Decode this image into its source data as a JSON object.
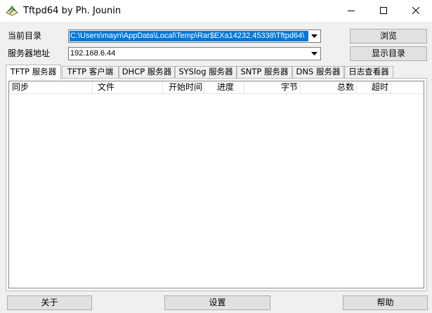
{
  "window": {
    "title": "Tftpd64 by Ph. Jounin"
  },
  "form": {
    "dir_label": "当前目录",
    "dir_value": "C:\\Users\\mayn\\AppData\\Local\\Temp\\Rar$EXa14232.45338\\Tftpd64\\",
    "addr_label": "服务器地址",
    "addr_value": "192.168.6.44",
    "browse_label": "浏览",
    "show_dir_label": "显示目录"
  },
  "tabs": [
    {
      "label": "TFTP 服务器",
      "active": true
    },
    {
      "label": "TFTP 客户端",
      "active": false
    },
    {
      "label": "DHCP 服务器",
      "active": false
    },
    {
      "label": "SYSlog 服务器",
      "active": false
    },
    {
      "label": "SNTP 服务器",
      "active": false
    },
    {
      "label": "DNS 服务器",
      "active": false
    },
    {
      "label": "日志查看器",
      "active": false
    }
  ],
  "columns": [
    "同步",
    "文件",
    "开始时间",
    "进度",
    "字节",
    "总数",
    "超时"
  ],
  "bottom": {
    "about_label": "关于",
    "settings_label": "设置",
    "help_label": "帮助"
  },
  "colors": {
    "selection": "#0078d7",
    "button_face": "#e1e1e1",
    "window_bg": "#f0f0f0"
  }
}
